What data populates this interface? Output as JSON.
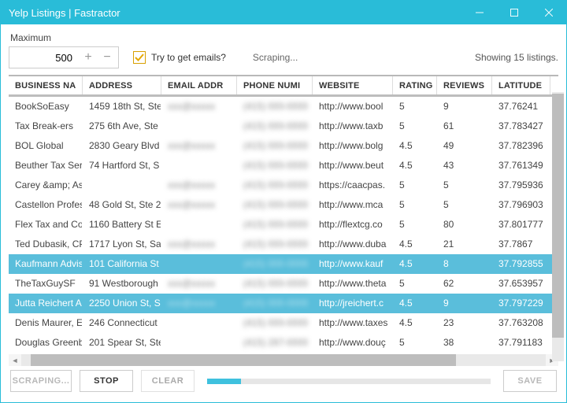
{
  "window": {
    "title": "Yelp Listings | Fastractor"
  },
  "controls": {
    "max_label": "Maximum",
    "max_value": "500",
    "emails_label": "Try to get emails?",
    "status": "Scraping...",
    "showing": "Showing 15 listings."
  },
  "columns": [
    "BUSINESS NA",
    "ADDRESS",
    "EMAIL ADDR",
    "PHONE NUMI",
    "WEBSITE",
    "RATING",
    "REVIEWS",
    "LATITUDE"
  ],
  "rows": [
    {
      "sel": false,
      "biz": "BookSoEasy",
      "addr": "1459 18th St, Ste",
      "email": "xxx@xxxxx",
      "phone": "(415) 000-0000",
      "site": "http://www.bool",
      "rating": "5",
      "reviews": "9",
      "lat": "37.76241"
    },
    {
      "sel": false,
      "biz": "Tax Break-ers",
      "addr": "275 6th Ave, Ste",
      "email": "",
      "phone": "(415) 000-0000",
      "site": "http://www.taxb",
      "rating": "5",
      "reviews": "61",
      "lat": "37.783427"
    },
    {
      "sel": false,
      "biz": "BOL Global",
      "addr": "2830 Geary Blvd",
      "email": "xxx@xxxxx",
      "phone": "(415) 000-0000",
      "site": "http://www.bolg",
      "rating": "4.5",
      "reviews": "49",
      "lat": "37.782396"
    },
    {
      "sel": false,
      "biz": "Beuther Tax Serv",
      "addr": "74 Hartford St, S",
      "email": "",
      "phone": "(415) 000-0000",
      "site": "http://www.beut",
      "rating": "4.5",
      "reviews": "43",
      "lat": "37.761349"
    },
    {
      "sel": false,
      "biz": "Carey &amp; As",
      "addr": "",
      "email": "xxx@xxxxx",
      "phone": "(415) 000-0000",
      "site": "https://caacpas.",
      "rating": "5",
      "reviews": "5",
      "lat": "37.795936"
    },
    {
      "sel": false,
      "biz": "Castellon Profes",
      "addr": "48 Gold St, Ste 2",
      "email": "xxx@xxxxx",
      "phone": "(415) 000-0000",
      "site": "http://www.mca",
      "rating": "5",
      "reviews": "5",
      "lat": "37.796903"
    },
    {
      "sel": false,
      "biz": "Flex Tax and Cor",
      "addr": "1160 Battery St E",
      "email": "",
      "phone": "(415) 000-0000",
      "site": "http://flextcg.co",
      "rating": "5",
      "reviews": "80",
      "lat": "37.801777"
    },
    {
      "sel": false,
      "biz": "Ted Dubasik, CP,",
      "addr": "1717 Lyon St, Sa",
      "email": "xxx@xxxxx",
      "phone": "(415) 000-0000",
      "site": "http://www.duba",
      "rating": "4.5",
      "reviews": "21",
      "lat": "37.7867"
    },
    {
      "sel": true,
      "biz": "Kaufmann Advis",
      "addr": "101 California St",
      "email": "",
      "phone": "(415) 000-0000",
      "site": "http://www.kauf",
      "rating": "4.5",
      "reviews": "8",
      "lat": "37.792855"
    },
    {
      "sel": false,
      "biz": "TheTaxGuySF",
      "addr": "91 Westborough",
      "email": "xxx@xxxxx",
      "phone": "(415) 000-0000",
      "site": "http://www.theta",
      "rating": "5",
      "reviews": "62",
      "lat": "37.653957"
    },
    {
      "sel": true,
      "biz": "Jutta Reichert As",
      "addr": "2250 Union St, S",
      "email": "xxx@xxxxx",
      "phone": "(415) 000-0000",
      "site": "http://jreichert.c",
      "rating": "4.5",
      "reviews": "9",
      "lat": "37.797229"
    },
    {
      "sel": false,
      "biz": "Denis Maurer, E,",
      "addr": "246 Connecticut",
      "email": "",
      "phone": "(415) 000-0000",
      "site": "http://www.taxes",
      "rating": "4.5",
      "reviews": "23",
      "lat": "37.763208"
    },
    {
      "sel": false,
      "biz": "Douglas Greenb",
      "addr": "201 Spear St, Ste",
      "email": "",
      "phone": "(415) 287-0000",
      "site": "http://www.douç",
      "rating": "5",
      "reviews": "38",
      "lat": "37.791183"
    }
  ],
  "footer": {
    "scraping": "SCRAPING...",
    "stop": "STOP",
    "clear": "CLEAR",
    "save": "SAVE"
  }
}
